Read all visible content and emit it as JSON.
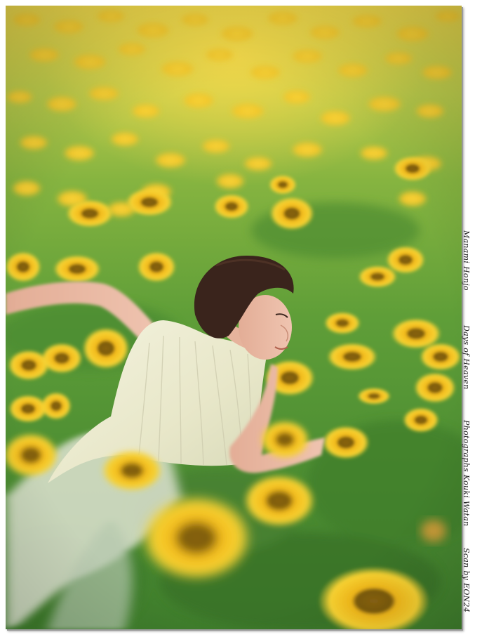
{
  "caption": {
    "model": "Manami Honjo",
    "title": "Days of Heaven",
    "photographer": "Photographs Kouki Watan",
    "scan": "Scan by EON24"
  },
  "colors": {
    "petal": "#f4c21e",
    "petal_light": "#f7da3a",
    "center": "#7a5a10",
    "leaf": "#4f8f34",
    "dress": "#efeed6",
    "hair": "#3a241c",
    "skin": "#e7b6a0"
  }
}
